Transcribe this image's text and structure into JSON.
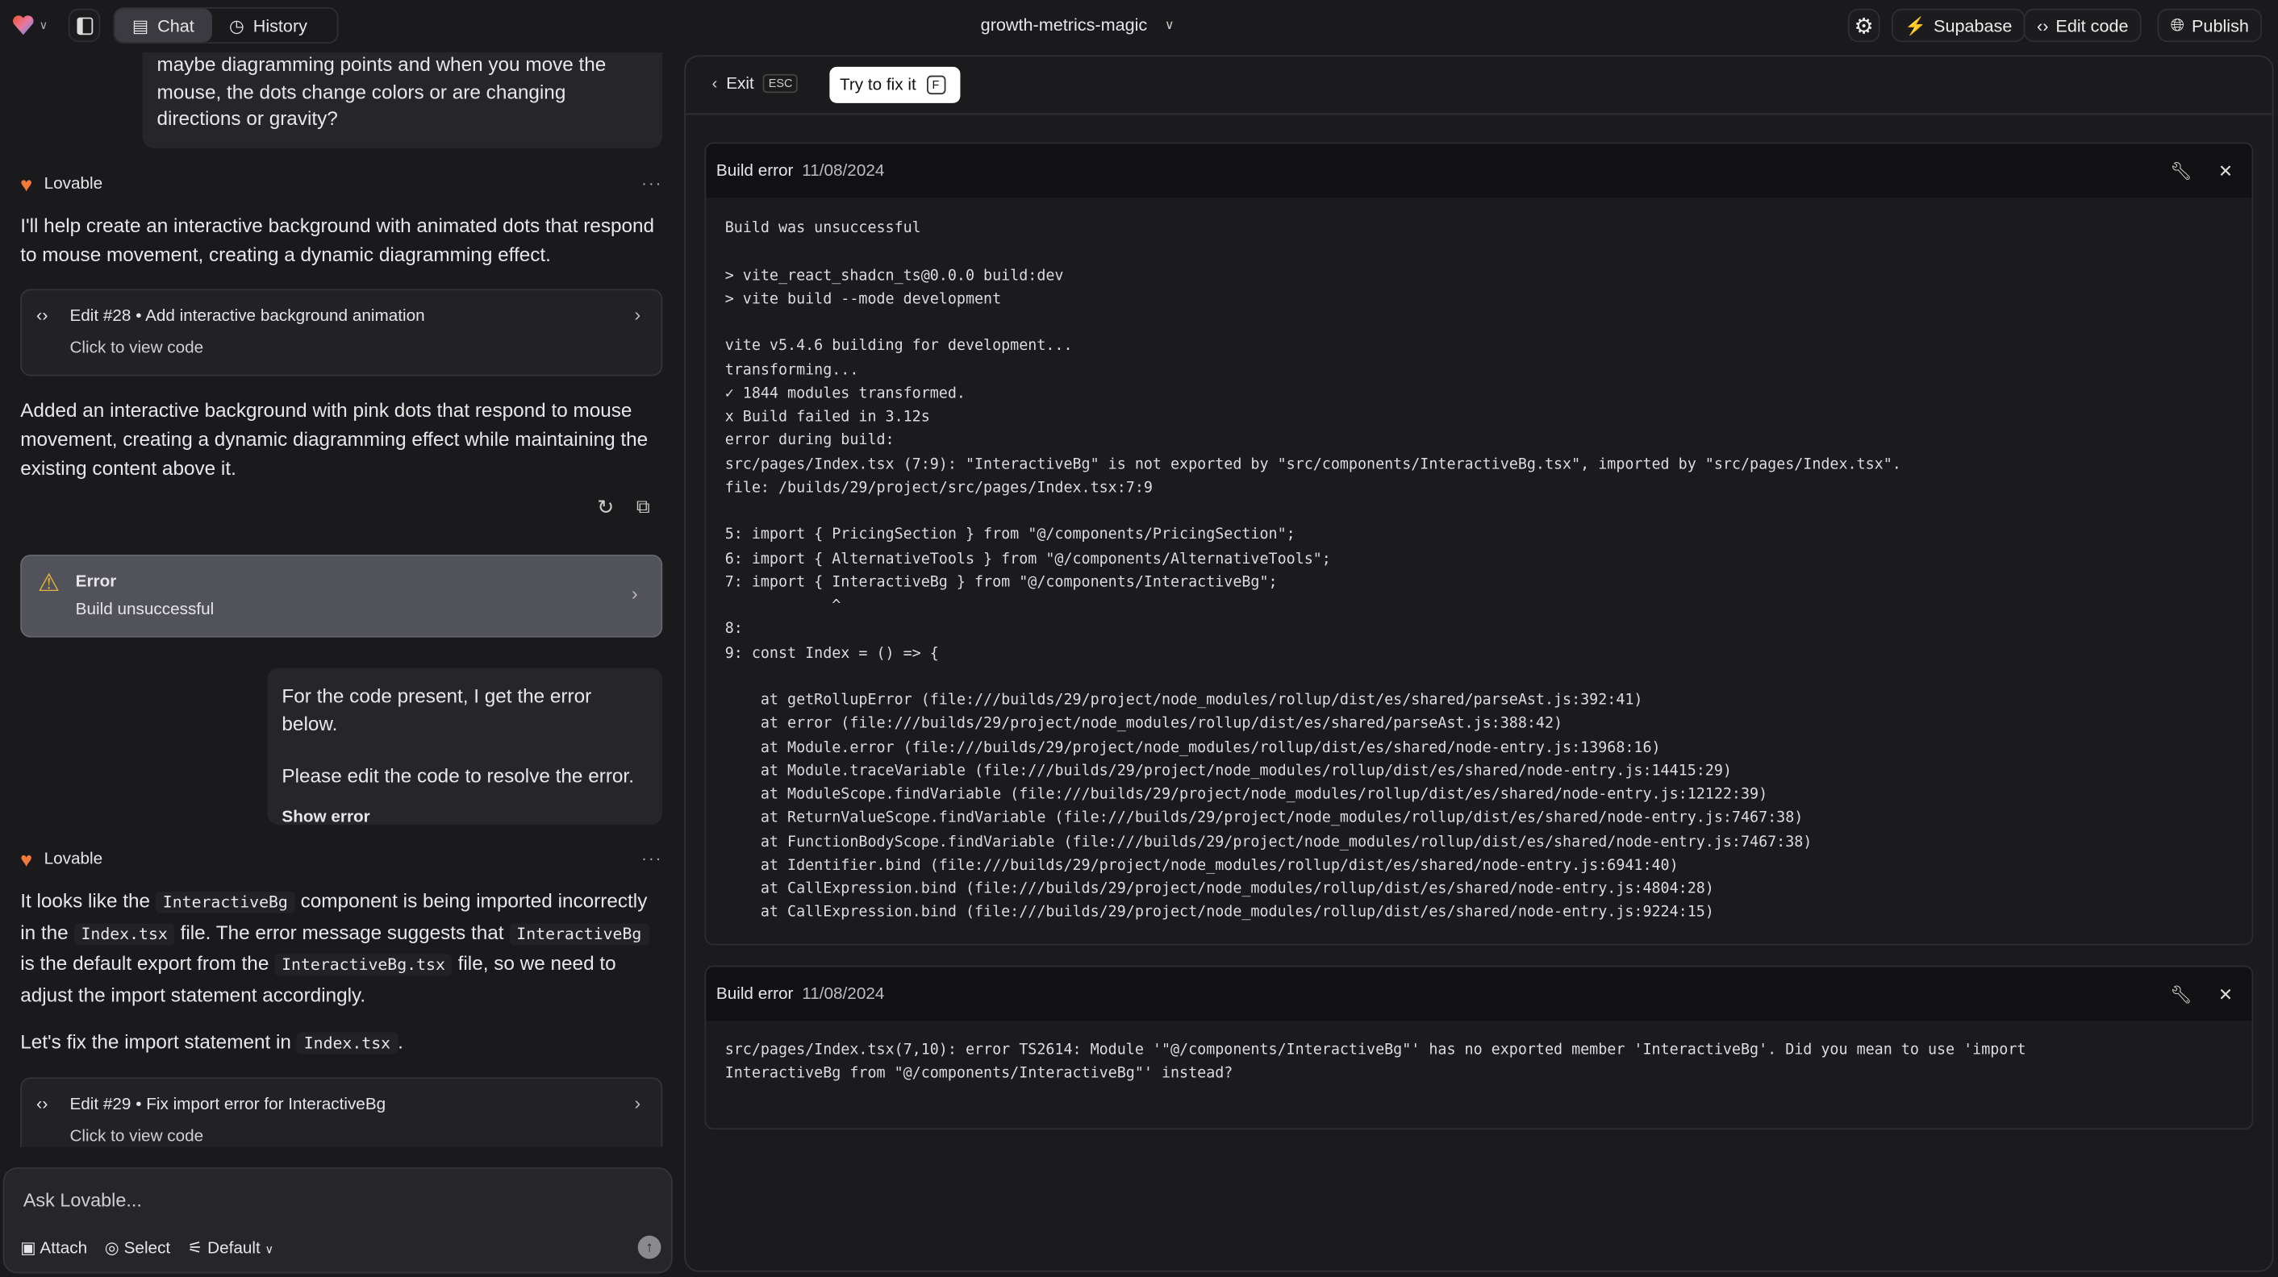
{
  "topbar": {
    "tabs": [
      {
        "label": "Chat",
        "active": true
      },
      {
        "label": "History",
        "active": false
      }
    ],
    "project_name": "growth-metrics-magic",
    "supabase_label": "Supabase",
    "edit_code_label": "Edit code",
    "publish_label": "Publish",
    "supabase_color": "#3ecf8e"
  },
  "chat": {
    "messages": {
      "user1_text": "maybe diagramming points and when you move the mouse, the dots change colors or are changing directions or gravity?",
      "assistant_name": "Lovable",
      "a1_text": "I'll help create an interactive background with animated dots that respond to mouse movement, creating a dynamic diagramming effect.",
      "edit28_title": "Edit #28 • Add interactive background animation",
      "edit_sub": "Click to view code",
      "a1_summary": "Added an interactive background with pink dots that respond to mouse movement, creating a dynamic diagramming effect while maintaining the existing content above it.",
      "error_title": "Error",
      "error_sub": "Build unsuccessful",
      "user2_line1": "For the code present, I get the error below.",
      "user2_line2": "Please edit the code to resolve the error.",
      "show_error": "Show error",
      "a2": {
        "p1": [
          "It looks like the ",
          "InteractiveBg",
          " component is being imported incorrectly in the ",
          "Index.tsx",
          " file. The error message suggests that ",
          "InteractiveBg",
          " is the default export from the ",
          "InteractiveBg.tsx",
          " file, so we need to adjust the import statement accordingly."
        ],
        "p2": [
          "Let's fix the import statement in ",
          "Index.tsx",
          "."
        ]
      },
      "edit29_title": "Edit #29 • Fix import error for InteractiveBg"
    },
    "input": {
      "placeholder": "Ask Lovable...",
      "attach": "Attach",
      "select": "Select",
      "mode": "Default"
    }
  },
  "panel": {
    "exit_label": "Exit",
    "exit_key": "ESC",
    "fix_label": "Try to fix it",
    "fix_key": "F",
    "errors": [
      {
        "title": "Build error",
        "date": "11/08/2024",
        "lines": [
          "Build was unsuccessful",
          "",
          "> vite_react_shadcn_ts@0.0.0 build:dev",
          "> vite build --mode development",
          "",
          "vite v5.4.6 building for development...",
          "transforming...",
          "✓ 1844 modules transformed.",
          "x Build failed in 3.12s",
          "error during build:",
          "src/pages/Index.tsx (7:9): \"InteractiveBg\" is not exported by \"src/components/InteractiveBg.tsx\", imported by \"src/pages/Index.tsx\".",
          "file: /builds/29/project/src/pages/Index.tsx:7:9",
          "",
          "5: import { PricingSection } from \"@/components/PricingSection\";",
          "6: import { AlternativeTools } from \"@/components/AlternativeTools\";",
          "7: import { InteractiveBg } from \"@/components/InteractiveBg\";",
          "            ^",
          "8:",
          "9: const Index = () => {",
          "",
          "    at getRollupError (file:///builds/29/project/node_modules/rollup/dist/es/shared/parseAst.js:392:41)",
          "    at error (file:///builds/29/project/node_modules/rollup/dist/es/shared/parseAst.js:388:42)",
          "    at Module.error (file:///builds/29/project/node_modules/rollup/dist/es/shared/node-entry.js:13968:16)",
          "    at Module.traceVariable (file:///builds/29/project/node_modules/rollup/dist/es/shared/node-entry.js:14415:29)",
          "    at ModuleScope.findVariable (file:///builds/29/project/node_modules/rollup/dist/es/shared/node-entry.js:12122:39)",
          "    at ReturnValueScope.findVariable (file:///builds/29/project/node_modules/rollup/dist/es/shared/node-entry.js:7467:38)",
          "    at FunctionBodyScope.findVariable (file:///builds/29/project/node_modules/rollup/dist/es/shared/node-entry.js:7467:38)",
          "    at Identifier.bind (file:///builds/29/project/node_modules/rollup/dist/es/shared/node-entry.js:6941:40)",
          "    at CallExpression.bind (file:///builds/29/project/node_modules/rollup/dist/es/shared/node-entry.js:4804:28)",
          "    at CallExpression.bind (file:///builds/29/project/node_modules/rollup/dist/es/shared/node-entry.js:9224:15)"
        ]
      },
      {
        "title": "Build error",
        "date": "11/08/2024",
        "lines": [
          "src/pages/Index.tsx(7,10): error TS2614: Module '\"@/components/InteractiveBg\"' has no exported member 'InteractiveBg'. Did you mean to use 'import",
          "InteractiveBg from \"@/components/InteractiveBg\"' instead?"
        ]
      }
    ]
  }
}
